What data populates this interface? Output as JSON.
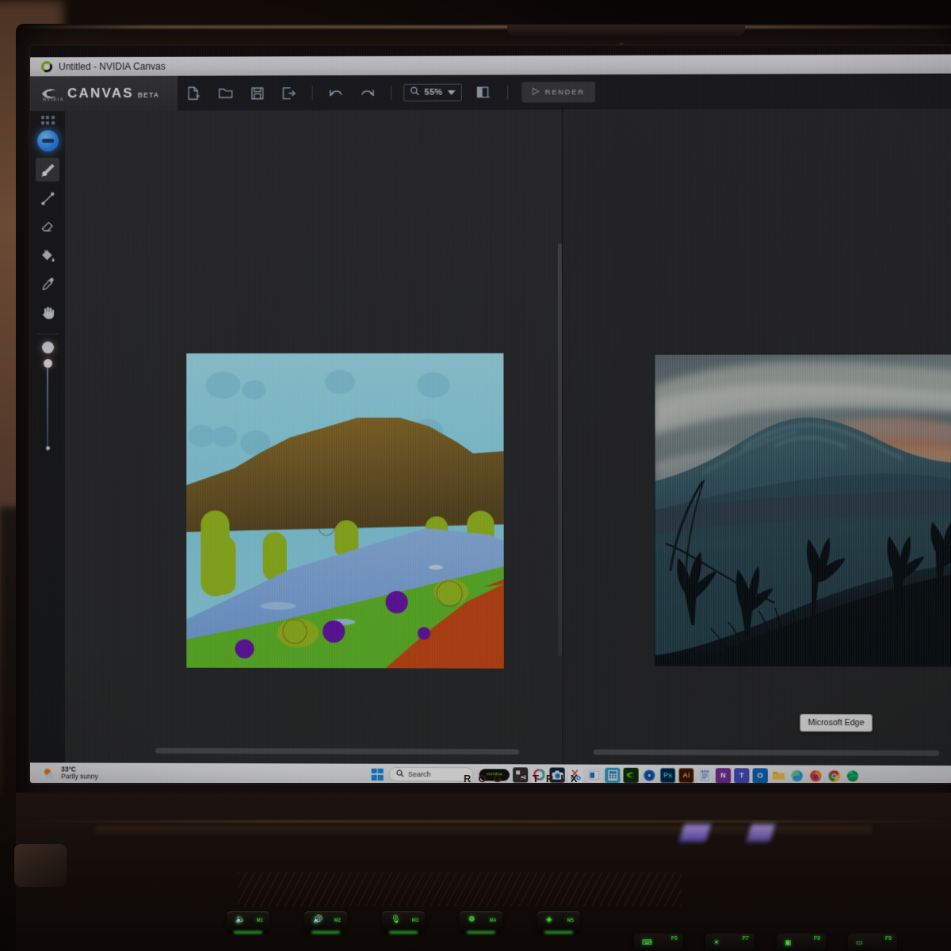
{
  "window": {
    "title": "Untitled - NVIDIA Canvas",
    "app_icon": "nvidia-canvas-logo-icon"
  },
  "brand": {
    "word": "CANVAS",
    "beta": "BETA",
    "vendor": "NVIDIA",
    "logo_icon": "nvidia-eye-logo-icon"
  },
  "toolbar": {
    "buttons": [
      {
        "name": "new-file-button",
        "icon": "new-file-icon",
        "label": "New"
      },
      {
        "name": "open-file-button",
        "icon": "open-folder-icon",
        "label": "Open"
      },
      {
        "name": "save-button",
        "icon": "save-disk-icon",
        "label": "Save"
      },
      {
        "name": "export-button",
        "icon": "export-icon",
        "label": "Export"
      },
      {
        "name": "undo-button",
        "icon": "undo-arrow-icon",
        "label": "Undo"
      },
      {
        "name": "redo-button",
        "icon": "redo-arrow-icon",
        "label": "Redo"
      }
    ],
    "zoom": {
      "icon": "magnifier-icon",
      "value": "55%",
      "chevron": "chevron-down-icon"
    },
    "split_view": {
      "icon": "split-view-icon",
      "label": "Split View"
    },
    "render": {
      "icon": "play-triangle-icon",
      "label": "RENDER"
    }
  },
  "rail": {
    "material_grid_icon": "material-grid-dots-icon",
    "current_material": {
      "name": "material-swatch",
      "color": "#2b8ef0"
    },
    "tools": [
      {
        "name": "paintbrush-tool",
        "icon": "paintbrush-icon",
        "label": "Paint Brush",
        "selected": true
      },
      {
        "name": "line-tool",
        "icon": "line-icon",
        "label": "Line",
        "selected": false
      },
      {
        "name": "eraser-tool",
        "icon": "eraser-icon",
        "label": "Eraser",
        "selected": false
      },
      {
        "name": "fill-tool",
        "icon": "paint-bucket-icon",
        "label": "Fill",
        "selected": false
      },
      {
        "name": "eyedropper-tool",
        "icon": "eyedropper-icon",
        "label": "Eyedropper",
        "selected": false
      },
      {
        "name": "pan-tool",
        "icon": "hand-icon",
        "label": "Pan",
        "selected": false
      }
    ],
    "brush_size": {
      "name": "brush-size-slider",
      "preview_icon": "brush-size-preview-icon",
      "percent": 8
    }
  },
  "panes": {
    "left": {
      "name": "segmentation-canvas",
      "scrollbar": "horizontal-scrollbar"
    },
    "right": {
      "name": "rendered-output-canvas",
      "scrollbar": "horizontal-scrollbar"
    },
    "splitter": {
      "name": "pane-splitter",
      "icon": "vertical-splitter-handle-icon"
    }
  },
  "artwork": {
    "segmentation": {
      "name": "segmentation-map",
      "materials": [
        {
          "label": "Sky",
          "color": "#8fdcf0"
        },
        {
          "label": "Cloud",
          "color": "#7ec9e4"
        },
        {
          "label": "Mountain",
          "color": "#8a6a22"
        },
        {
          "label": "Water",
          "color": "#86b4ea"
        },
        {
          "label": "Grass",
          "color": "#66c42a"
        },
        {
          "label": "Bush",
          "color": "#9fc41f"
        },
        {
          "label": "Flowers",
          "color": "#6a12b0"
        },
        {
          "label": "Dirt",
          "color": "#cf4a14"
        }
      ]
    },
    "rendered": {
      "name": "rendered-photo",
      "description": "Sunset mountain landscape with silhouetted grass",
      "palette": {
        "sky_dark": "#4a5b66",
        "sky_light": "#c8ccc6",
        "mountain": "#2c4a55",
        "sunset_red": "#e02418",
        "sunset_gold": "#f0b52a",
        "foreground": "#0c1418"
      }
    }
  },
  "tooltip": {
    "name": "taskbar-tooltip",
    "text": "Microsoft Edge"
  },
  "taskbar": {
    "weather": {
      "icon": "partly-sunny-icon",
      "temperature": "33°C",
      "condition": "Partly sunny"
    },
    "start": {
      "name": "start-button",
      "icon": "windows-logo-icon"
    },
    "search": {
      "name": "taskbar-search",
      "icon": "search-icon",
      "placeholder": "Search"
    },
    "items": [
      {
        "name": "taskbar-nvidia-app",
        "icon": "nvidia-pill-icon",
        "label": "NVIDIA",
        "kind": "pill",
        "color": "#101010",
        "text": "nvidia"
      },
      {
        "name": "taskbar-file-explorer",
        "icon": "file-explorer-icon",
        "label": "File Explorer",
        "kind": "glyph",
        "color": "#2b2b2b",
        "text": "⬛"
      },
      {
        "name": "taskbar-copilot",
        "icon": "copilot-icon",
        "label": "Copilot",
        "kind": "glyph",
        "color": "#e8e8ea",
        "text": "◐"
      },
      {
        "name": "taskbar-camera",
        "icon": "camera-icon",
        "label": "Camera",
        "kind": "glyph",
        "color": "#1f2f52",
        "text": "◉"
      },
      {
        "name": "taskbar-snipping-tool",
        "icon": "snipping-tool-icon",
        "label": "Snipping Tool",
        "kind": "glyph",
        "color": "#f0f0f2",
        "text": "✂"
      },
      {
        "name": "taskbar-widgets",
        "icon": "widgets-icon",
        "label": "Widgets",
        "kind": "glyph",
        "color": "#e6e9ee",
        "text": "▣"
      },
      {
        "name": "taskbar-calculator",
        "icon": "calculator-icon",
        "label": "Calculator",
        "kind": "glyph",
        "color": "#2a7fb8",
        "text": "⌸"
      },
      {
        "name": "taskbar-nvidia-control",
        "icon": "nvidia-green-icon",
        "label": "NVIDIA Control",
        "kind": "glyph",
        "color": "#0e3b0e",
        "text": "◆"
      },
      {
        "name": "taskbar-geforce",
        "icon": "geforce-experience-icon",
        "label": "GeForce",
        "kind": "glyph",
        "color": "#1566c9",
        "text": "●"
      },
      {
        "name": "taskbar-photoshop",
        "icon": "photoshop-icon",
        "label": "Photoshop",
        "kind": "glyph",
        "color": "#0d2a4d",
        "text": "Ps"
      },
      {
        "name": "taskbar-illustrator",
        "icon": "illustrator-icon",
        "label": "Illustrator",
        "kind": "glyph",
        "color": "#3a1c06",
        "text": "Ai"
      },
      {
        "name": "taskbar-notepad",
        "icon": "notepad-icon",
        "label": "Notepad",
        "kind": "glyph",
        "color": "#dfe8f4",
        "text": "☰"
      },
      {
        "name": "taskbar-onenote",
        "icon": "onenote-icon",
        "label": "OneNote",
        "kind": "glyph",
        "color": "#7a2f9e",
        "text": "N"
      },
      {
        "name": "taskbar-teams",
        "icon": "teams-icon",
        "label": "Teams",
        "kind": "glyph",
        "color": "#4a52c4",
        "text": "T"
      },
      {
        "name": "taskbar-outlook",
        "icon": "outlook-icon",
        "label": "Outlook",
        "kind": "glyph",
        "color": "#0f6cbd",
        "text": "O"
      },
      {
        "name": "taskbar-folder",
        "icon": "folder-icon",
        "label": "Folder",
        "kind": "glyph",
        "color": "#e8a21c",
        "text": "▰"
      },
      {
        "name": "taskbar-edge-dev",
        "icon": "edge-dev-icon",
        "label": "Edge Dev",
        "kind": "glyph",
        "color": "#1f8fd0",
        "text": "◔"
      },
      {
        "name": "taskbar-firefox",
        "icon": "firefox-icon",
        "label": "Firefox",
        "kind": "glyph",
        "color": "#c72b2b",
        "text": "◉"
      },
      {
        "name": "taskbar-chrome",
        "icon": "chrome-icon",
        "label": "Chrome",
        "kind": "glyph",
        "color": "#1c9b4c",
        "text": "◎"
      },
      {
        "name": "taskbar-microsoft-edge",
        "icon": "edge-icon",
        "label": "Microsoft Edge",
        "kind": "glyph",
        "color": "#0f9d58",
        "text": "◑",
        "active": true
      }
    ]
  },
  "laptop": {
    "brand_text": "ROG STRIX",
    "keys_row1": [
      {
        "name": "key-m1",
        "glyph": "🔈",
        "label": "M1"
      },
      {
        "name": "key-m2",
        "glyph": "🔊",
        "label": "M2"
      },
      {
        "name": "key-m3",
        "glyph": "🎙",
        "label": "M3"
      },
      {
        "name": "key-m4",
        "glyph": "❁",
        "label": "M4"
      },
      {
        "name": "key-m5",
        "glyph": "◈",
        "label": "M5"
      }
    ],
    "keys_row2": [
      {
        "name": "key-f6",
        "glyph": "⌨",
        "label": "F6"
      },
      {
        "name": "key-f7",
        "glyph": "☀",
        "label": "F7"
      },
      {
        "name": "key-f8",
        "glyph": "▣",
        "label": "F8"
      },
      {
        "name": "key-f9",
        "glyph": "▭",
        "label": "F9"
      }
    ]
  }
}
